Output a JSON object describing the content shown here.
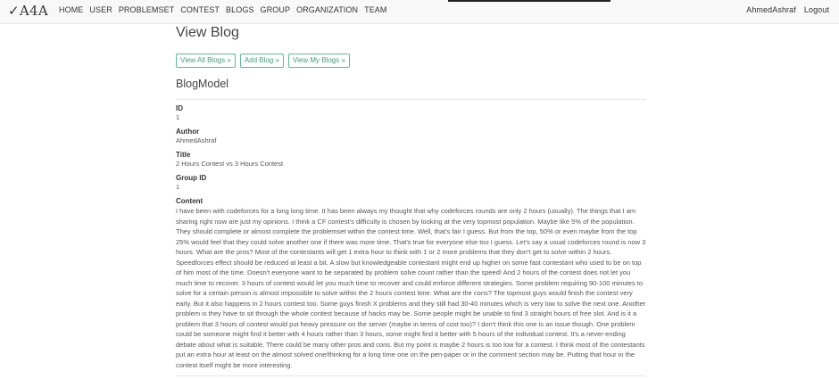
{
  "nav": {
    "brand": "✓A4A",
    "links": [
      "HOME",
      "USER",
      "PROBLEMSET",
      "CONTEST",
      "BLOGS",
      "GROUP",
      "ORGANIZATION",
      "TEAM"
    ],
    "user": "AhmedAshraf",
    "logout": "Logout"
  },
  "page": {
    "title": "View Blog",
    "buttons": [
      "View All Blogs »",
      "Add Blog »",
      "View My Blogs »"
    ],
    "model_title": "BlogModel"
  },
  "fields": [
    {
      "label": "ID",
      "value": "1"
    },
    {
      "label": "Author",
      "value": "AhmedAshraf"
    },
    {
      "label": "Title",
      "value": "2 Hours Contest vs 3 Hours Contest"
    },
    {
      "label": "Group ID",
      "value": "1"
    }
  ],
  "content": {
    "label": "Content",
    "value": "I have been with codeforces for a long long time. It has been always my thought that why codeforces rounds are only 2 hours (usually). The things that I am sharing right now are just my opinions. I think a CF contest's difficulty is chosen by looking at the very topmost population. Maybe like 5% of the population. They should complete or almost complete the problemset within the contest time. Well, that's fair I guess. But from the top, 50% or even maybe from the top 25% would feel that they could solve another one if there was more time. That's true for everyone else too I guess. Let's say a usual codeforces round is now 3 hours. What are the pros? Most of the contestants will get 1 extra hour to think with 1 or 2 more problems that they don't get to solve within 2 hours. Speedforces effect should be reduced at least a bit. A slow but knowledgeable contestant might end up higher on some fast contestant who used to be on top of him most of the time. Doesn't everyone want to be separated by problem solve count rather than the speed! And 2 hours of the contest does not let you much time to recover. 3 hours of contest would let you much time to recover and could enforce different strategies. Some problem requiring 90-100 minutes to solve for a certain person is almost impossible to solve within the 2 hours contest time. What are the cons? The topmost guys would finish the contest very early. But it also happens in 2 hours contest too. Some guys finish X problems and they still had 30-40 minutes which is very low to solve the next one. Another problem is they have to sit through the whole contest because of hacks may be. Some people might be unable to find 3 straight hours of free slot. And is it a problem that 3 hours of contest would put heavy pressure on the server (maybe in terms of cost too)? I don't think this one is an issue though. One problem could be someone might find it better with 4 hours rather than 3 hours, some might find it better with 5 hours of the individual contest. It's a never-ending debate about what is suitable. There could be many other pros and cons. But my point is maybe 2 hours is too low for a contest. I think most of the contestants put an extra hour at least on the almost solved one/thinking for a long time one on the pen-paper or in the comment section may be. Putting that hour in the contest itself might be more interesting."
  }
}
